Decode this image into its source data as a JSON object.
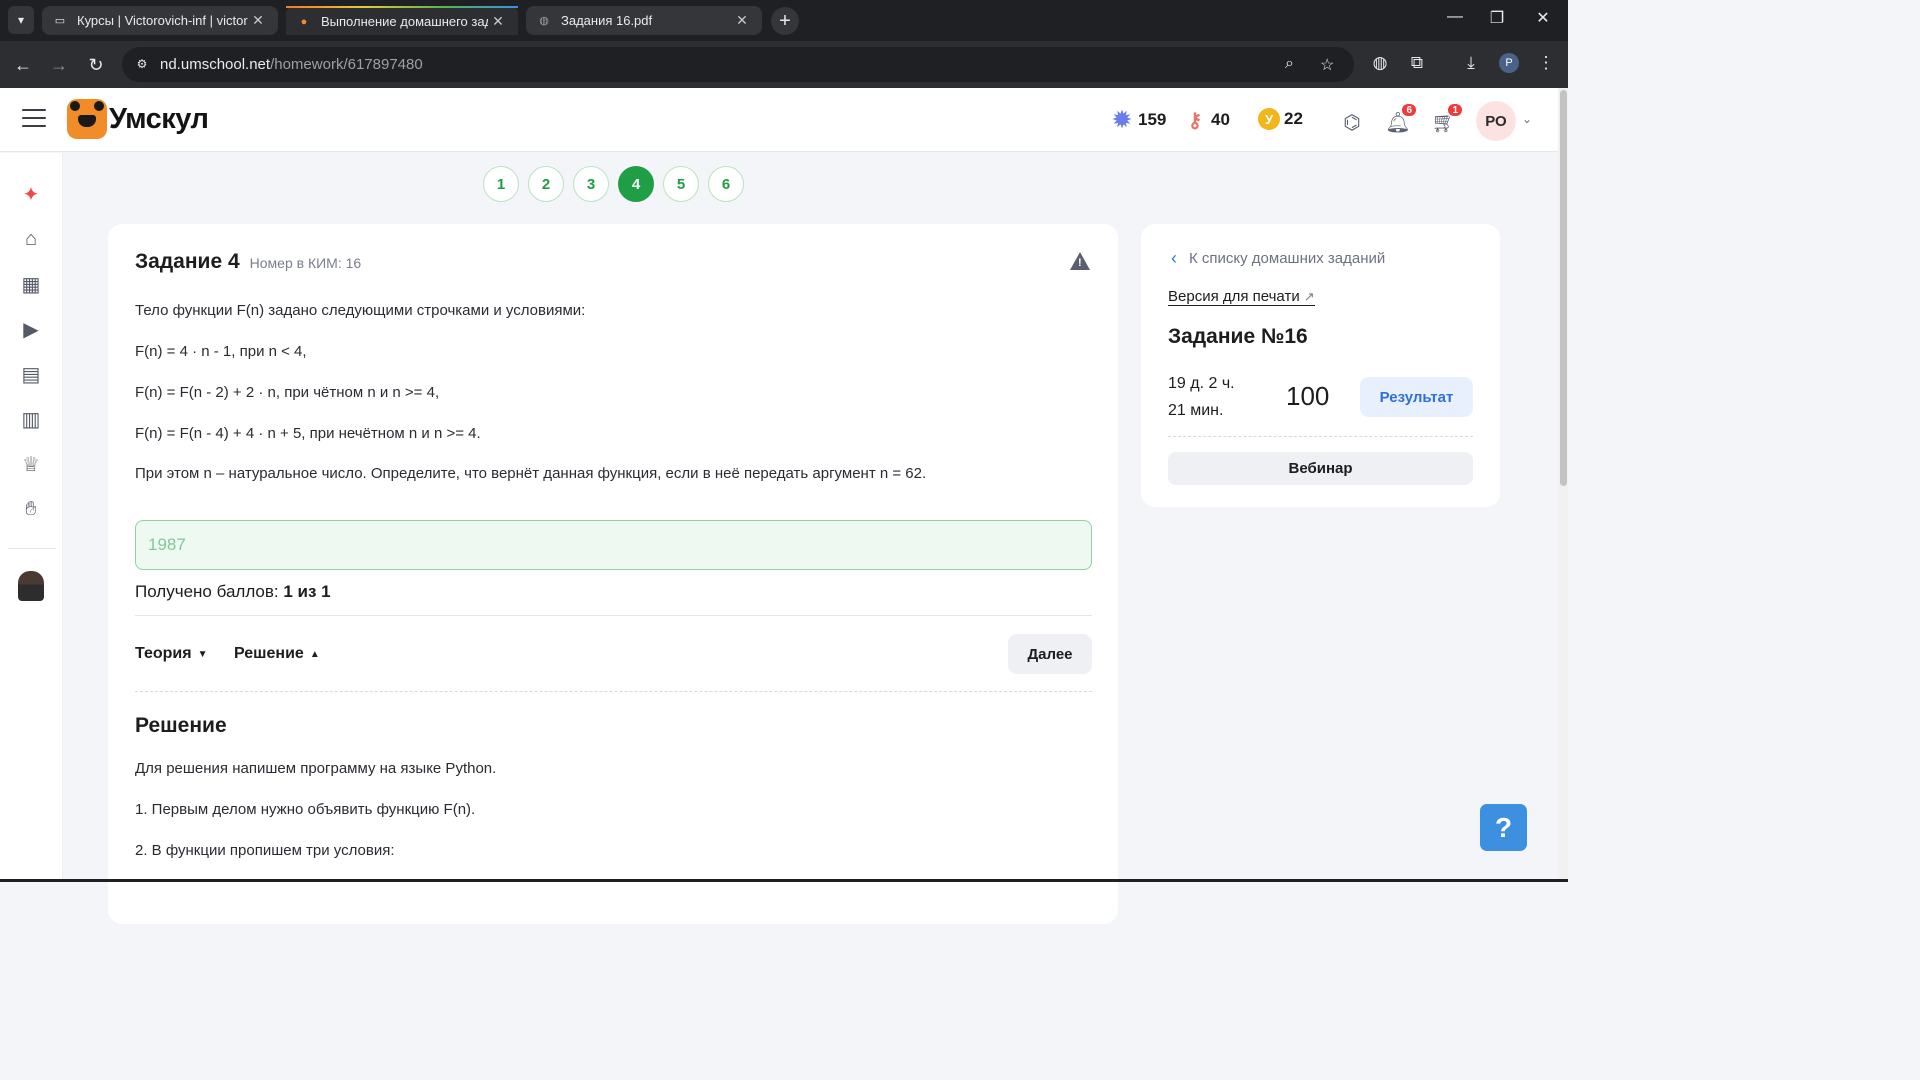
{
  "browser": {
    "tabs": [
      {
        "title": "Курсы | Victorovich-inf | victoro",
        "favicon": "monitor-icon"
      },
      {
        "title": "Выполнение домашнего задан",
        "favicon": "bear-icon",
        "active": true
      },
      {
        "title": "Задания 16.pdf",
        "favicon": "globe-icon"
      }
    ],
    "url_host": "nd.umschool.net",
    "url_path": "/homework/617897480",
    "profile_initial": "P"
  },
  "header": {
    "logo_text": "Умскул",
    "stats": [
      {
        "name": "rating",
        "value": "159",
        "icon": "star-badge-icon",
        "color": "#6a7dea"
      },
      {
        "name": "keys",
        "value": "40",
        "icon": "key-icon",
        "color": "#e4756a"
      },
      {
        "name": "coins",
        "value": "22",
        "icon": "coin-icon",
        "color": "#f2b51b",
        "symbol": "У"
      }
    ],
    "notifications_count": "6",
    "cart_count": "1",
    "avatar_initials": "РО"
  },
  "pager": [
    "1",
    "2",
    "3",
    "4",
    "5",
    "6"
  ],
  "pager_active": 3,
  "task": {
    "title": "Задание 4",
    "kim_number": "Номер в КИМ: 16",
    "paragraphs": [
      "Тело функции F(n) задано следующими строчками и условиями:",
      "F(n) = 4 · n - 1, при n < 4,",
      "F(n) = F(n - 2) + 2 · n, при чётном n и n >= 4,",
      "F(n) = F(n - 4) + 4 · n + 5, при нечётном n и n >= 4.",
      "При этом n – натуральное число. Определите, что вернёт данная функция, если в неё передать аргумент n = 62."
    ],
    "answer_value": "1987",
    "score_label": "Получено баллов: ",
    "score_value": "1 из 1",
    "theory_label": "Теория",
    "solution_label": "Решение",
    "next_label": "Далее"
  },
  "solution": {
    "title": "Решение",
    "paragraphs": [
      "Для решения напишем программу на языке Python.",
      "1. Первым делом нужно объявить функцию F(n).",
      "2. В функции пропишем три условия:"
    ]
  },
  "sidebar": {
    "back_label": "К списку домашних заданий",
    "print_label": "Версия для печати",
    "task_title": "Задание №16",
    "timer_line1": "19 д. 2 ч.",
    "timer_line2": "21 мин.",
    "score": "100",
    "result_label": "Результат",
    "webinar_label": "Вебинар"
  },
  "help_label": "?"
}
